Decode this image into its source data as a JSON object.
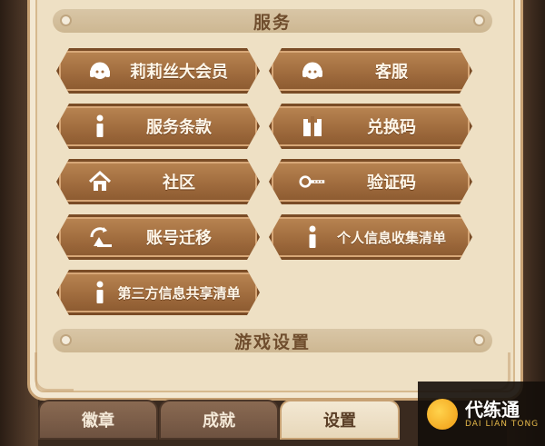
{
  "sections": {
    "services_title": "服务",
    "game_settings_title": "游戏设置"
  },
  "buttons": [
    {
      "label": "莉莉丝大会员",
      "icon": "headset-icon"
    },
    {
      "label": "客服",
      "icon": "headset-icon"
    },
    {
      "label": "服务条款",
      "icon": "info-icon"
    },
    {
      "label": "兑换码",
      "icon": "gift-icon"
    },
    {
      "label": "社区",
      "icon": "home-icon"
    },
    {
      "label": "验证码",
      "icon": "key-icon"
    },
    {
      "label": "账号迁移",
      "icon": "account-transfer-icon"
    },
    {
      "label": "个人信息收集清单",
      "icon": "info-icon"
    },
    {
      "label": "第三方信息共享清单",
      "icon": "info-icon"
    }
  ],
  "tabs": [
    {
      "label": "徽章",
      "active": false
    },
    {
      "label": "成就",
      "active": false
    },
    {
      "label": "设置",
      "active": true
    }
  ],
  "watermark": {
    "title": "代练通",
    "subtitle": "DAI LIAN TONG"
  },
  "colors": {
    "panel": "#eee0c4",
    "button": "#a06c3e",
    "button_text": "#fff7ea",
    "header_text": "#6f4d2d"
  }
}
